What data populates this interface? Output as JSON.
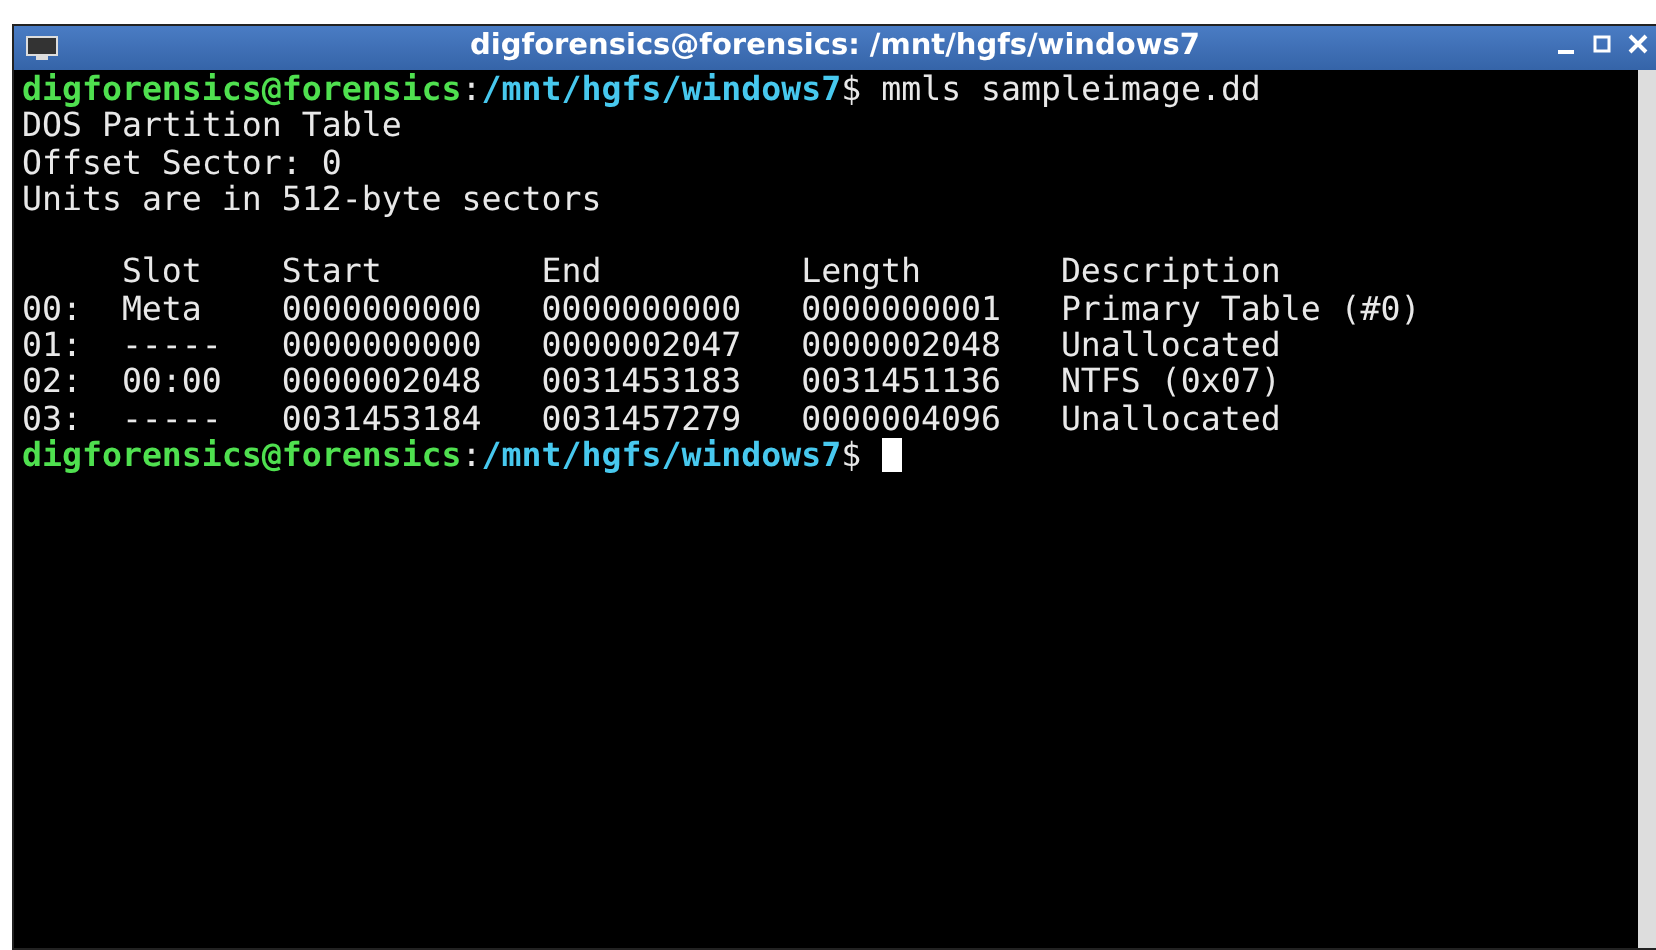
{
  "window": {
    "title": "digforensics@forensics: /mnt/hgfs/windows7"
  },
  "lines": [
    {
      "kind": "prompt",
      "user_host": "digforensics@forensics",
      "separator": ":",
      "path": "/mnt/hgfs/windows7",
      "symbol": "$",
      "command": "mmls sampleimage.dd"
    },
    {
      "kind": "output",
      "text": "DOS Partition Table"
    },
    {
      "kind": "output",
      "text": "Offset Sector: 0"
    },
    {
      "kind": "output",
      "text": "Units are in 512-byte sectors"
    },
    {
      "kind": "blank"
    },
    {
      "kind": "table",
      "columns": [
        "",
        "Slot",
        "Start",
        "End",
        "Length",
        "Description"
      ],
      "rows": [
        [
          "00:",
          "Meta",
          "0000000000",
          "0000000000",
          "0000000001",
          "Primary Table (#0)"
        ],
        [
          "01:",
          "-----",
          "0000000000",
          "0000002047",
          "0000002048",
          "Unallocated"
        ],
        [
          "02:",
          "00:00",
          "0000002048",
          "0031453183",
          "0031451136",
          "NTFS (0x07)"
        ],
        [
          "03:",
          "-----",
          "0031453184",
          "0031457279",
          "0000004096",
          "Unallocated"
        ]
      ]
    },
    {
      "kind": "prompt",
      "user_host": "digforensics@forensics",
      "separator": ":",
      "path": "/mnt/hgfs/windows7",
      "symbol": "$",
      "cursor": true
    }
  ]
}
